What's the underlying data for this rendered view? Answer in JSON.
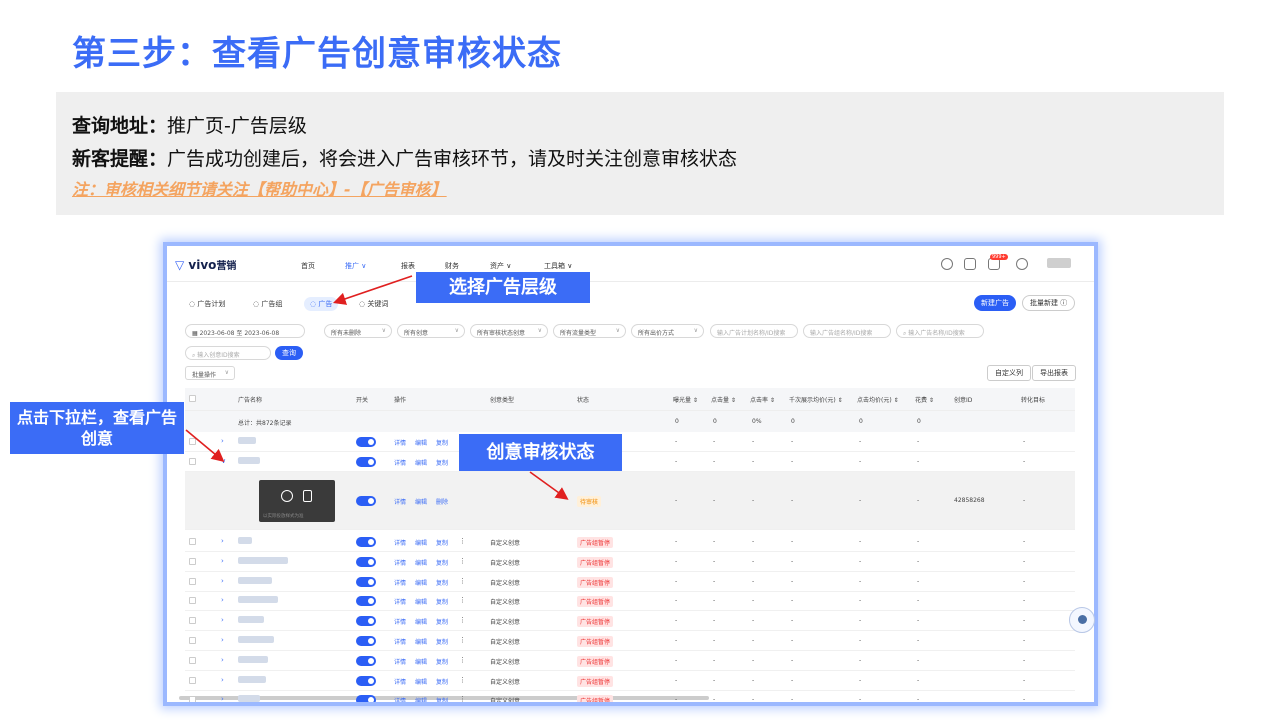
{
  "slide": {
    "title": "第三步：查看广告创意审核状态",
    "info": {
      "query_label": "查询地址：",
      "query_value": "推广页-广告层级",
      "tip_label": "新客提醒：",
      "tip_value": "广告成功创建后，将会进入广告审核环节，请及时关注创意审核状态",
      "note": "注：审核相关细节请关注【帮助中心】-【广告审核】"
    },
    "callouts": {
      "select_level": "选择广告层级",
      "dropdown_view": "点击下拉栏，查看广告创意",
      "creative_status": "创意审核状态"
    }
  },
  "app": {
    "logo_mark": "▽",
    "logo_text": "vivo",
    "logo_suffix": "营销",
    "nav": [
      "首页",
      "推广 ∨",
      "报表",
      "财务",
      "资产 ∨",
      "工具箱 ∨"
    ],
    "message_badge": "999+",
    "tabs": [
      "广告计划",
      "广告组",
      "广告",
      "关键词"
    ],
    "new_ad_button": "新建广告",
    "batch_new_button": "批量新建 ⓘ",
    "filters": {
      "date_start": "2023-06-08",
      "date_sep": "至",
      "date_end": "2023-06-08",
      "deleted": "所有未删除",
      "creative": "所有创意",
      "review_status": "所有审核状态创意",
      "traffic_type": "所有流量类型",
      "bid_method": "所有出价方式",
      "search_plan_placeholder": "输入广告计划名称/ID搜索",
      "search_group_placeholder": "输入广告组名称/ID搜索",
      "search_ad_placeholder": "输入广告名称/ID搜索",
      "search_creative_placeholder": "输入创意ID搜索",
      "query_button": "查询",
      "batch_ops": "批量操作",
      "custom_columns": "自定义列",
      "export_report": "导出报表"
    },
    "table": {
      "headers": [
        "广告名称",
        "开关",
        "操作",
        "创意类型",
        "状态",
        "曝光量 ⇕",
        "点击量 ⇕",
        "点击率 ⇕",
        "千次展示均价(元) ⇕",
        "点击均价(元) ⇕",
        "花费 ⇕",
        "创意ID",
        "转化目标"
      ],
      "total_label": "总计：共872条记录",
      "total_values": [
        "0",
        "0",
        "0%",
        "0",
        "0",
        "0"
      ],
      "actions": [
        "详情",
        "编辑",
        "复制"
      ],
      "expanded_actions": [
        "详情",
        "编辑",
        "删除"
      ],
      "expanded_status": "待审核",
      "expanded_creative_id": "42858268",
      "preview_caption": "以实际投放样式为准",
      "creative_type": "自定义创意",
      "status_paused": "广告组暂停",
      "dash": "-"
    }
  }
}
